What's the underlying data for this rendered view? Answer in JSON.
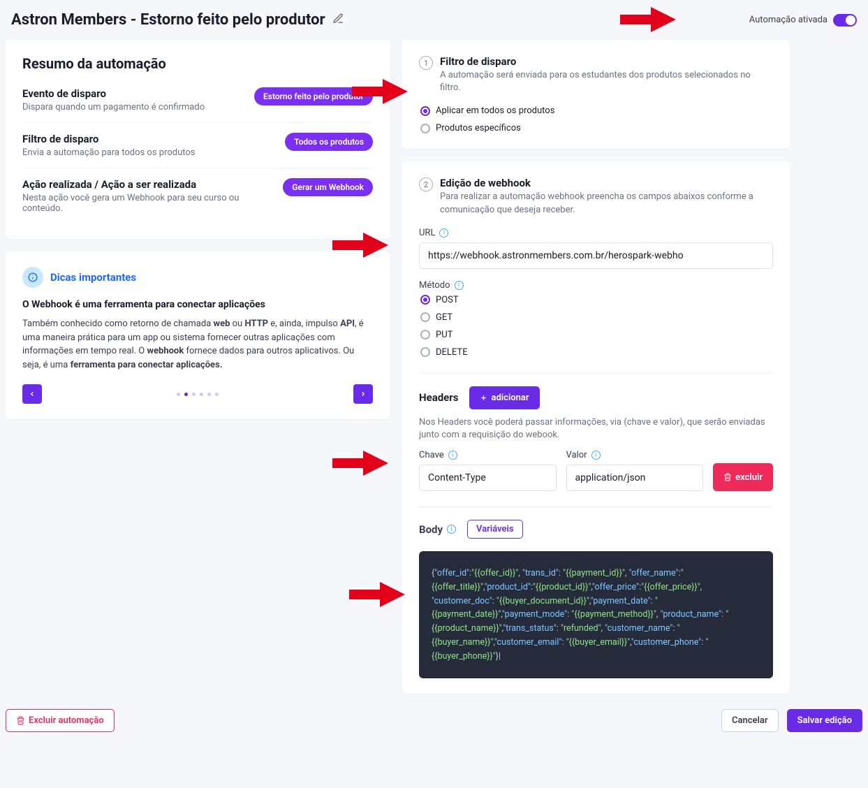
{
  "header": {
    "title": "Astron Members - Estorno feito pelo produtor",
    "toggle_label": "Automação ativada"
  },
  "summary": {
    "title": "Resumo da automação",
    "items": [
      {
        "title": "Evento de disparo",
        "desc": "Dispara quando um pagamento é confirmado",
        "badge": "Estorno feito pelo produtor"
      },
      {
        "title": "Filtro de disparo",
        "desc": "Envia a automação para todos os produtos",
        "badge": "Todos os produtos"
      },
      {
        "title": "Ação realizada / Ação a ser realizada",
        "desc": "Nesta ação você gera um Webhook para seu curso ou conteúdo.",
        "badge": "Gerar um Webhook"
      }
    ]
  },
  "tips": {
    "heading": "Dicas importantes",
    "bold": "O Webhook é uma ferramenta para conectar aplicações",
    "body_pre": "Também conhecido como retorno de chamada ",
    "b1": "web",
    "mid1": " ou ",
    "b2": "HTTP",
    "mid2": " e, ainda, impulso ",
    "b3": "API",
    "rest": ", é uma maneira prática para um app ou sistema fornecer outras aplicações com informações em tempo real. O ",
    "b4": "webhook",
    "mid3": " fornece dados para outros aplicativos. Ou seja, é uma ",
    "b5": "ferramenta para conectar aplicações."
  },
  "filter": {
    "step": "1",
    "title": "Filtro de disparo",
    "desc": "A automação será enviada para os estudantes dos produtos selecionados no filtro.",
    "opt1": "Aplicar em todos os produtos",
    "opt2": "Produtos específicos"
  },
  "webhook": {
    "step": "2",
    "title": "Edição de webhook",
    "desc": "Para realizar a automação webhook preencha os campos abaixos conforme a comunicação que deseja receber.",
    "url_label": "URL",
    "url_value": "https://webhook.astronmembers.com.br/herospark-webho",
    "method_label": "Método",
    "methods": [
      "POST",
      "GET",
      "PUT",
      "DELETE"
    ],
    "headers_label": "Headers",
    "add_btn": "adicionar",
    "headers_note": "Nos Headers você poderá passar informações, via (chave e valor), que serão enviadas junto com a requisição do webook.",
    "key_label": "Chave",
    "val_label": "Valor",
    "key_value": "Content-Type",
    "val_value": "application/json",
    "delete_btn": "excluir",
    "body_label": "Body",
    "vars_btn": "Variáveis",
    "code_tokens": [
      [
        "p",
        "{"
      ],
      [
        "k",
        "\"offer_id\""
      ],
      [
        "p",
        ":"
      ],
      [
        "v",
        "\"{{offer_id}}\""
      ],
      [
        "p",
        ", "
      ],
      [
        "k",
        "\"trans_id\""
      ],
      [
        "p",
        ": "
      ],
      [
        "v",
        "\"{{payment_id}}\""
      ],
      [
        "p",
        ", "
      ],
      [
        "k",
        "\"offer_name\""
      ],
      [
        "p",
        ":"
      ],
      [
        "v",
        "\"{{offer_title}}\""
      ],
      [
        "p",
        ","
      ],
      [
        "k",
        "\"product_id\""
      ],
      [
        "p",
        ":"
      ],
      [
        "v",
        "\"{{product_id}}\""
      ],
      [
        "p",
        ","
      ],
      [
        "k",
        "\"offer_price\""
      ],
      [
        "p",
        ":"
      ],
      [
        "v",
        "\"{{offer_price}}\""
      ],
      [
        "p",
        ", "
      ],
      [
        "k",
        "\"customer_doc\""
      ],
      [
        "p",
        ": "
      ],
      [
        "v",
        "\"{{buyer_document_id}}\""
      ],
      [
        "p",
        ","
      ],
      [
        "k",
        "\"payment_date\""
      ],
      [
        "p",
        ": "
      ],
      [
        "v",
        "\"{{payment_date}}\""
      ],
      [
        "p",
        ","
      ],
      [
        "k",
        "\"payment_mode\""
      ],
      [
        "p",
        ": "
      ],
      [
        "v",
        "\"{{payment_method}}\""
      ],
      [
        "p",
        ", "
      ],
      [
        "k",
        "\"product_name\""
      ],
      [
        "p",
        ": "
      ],
      [
        "v",
        "\"{{product_name}}\""
      ],
      [
        "p",
        ","
      ],
      [
        "k",
        "\"trans_status\""
      ],
      [
        "p",
        ": "
      ],
      [
        "v",
        "\"refunded\""
      ],
      [
        "p",
        ", "
      ],
      [
        "k",
        "\"customer_name\""
      ],
      [
        "p",
        ": "
      ],
      [
        "v",
        "\"{{buyer_name}}\""
      ],
      [
        "p",
        ","
      ],
      [
        "k",
        "\"customer_email\""
      ],
      [
        "p",
        ": "
      ],
      [
        "v",
        "\"{{buyer_email}}\""
      ],
      [
        "p",
        ","
      ],
      [
        "k",
        "\"customer_phone\""
      ],
      [
        "p",
        ": "
      ],
      [
        "v",
        "\"{{buyer_phone}}\""
      ],
      [
        "p",
        "}"
      ],
      [
        "p",
        "|"
      ]
    ]
  },
  "footer": {
    "delete": "Excluir automação",
    "cancel": "Cancelar",
    "save": "Salvar edição"
  }
}
